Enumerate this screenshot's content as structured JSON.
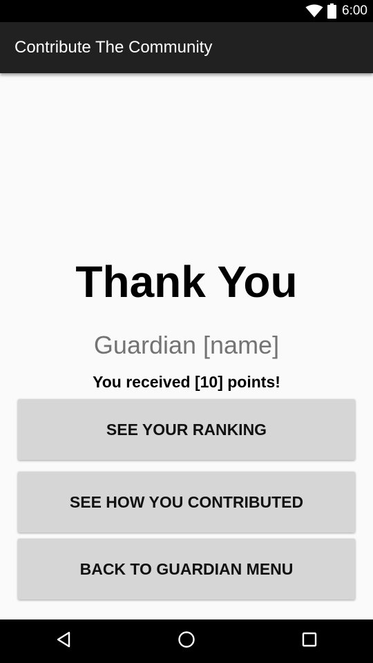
{
  "status_bar": {
    "time": "6:00",
    "icons": [
      "wifi-icon",
      "battery-icon"
    ]
  },
  "app_bar": {
    "title": "Contribute The Community"
  },
  "main": {
    "heading": "Thank You",
    "guardian_name": "Guardian [name]",
    "points_message": "You received [10] points!",
    "buttons": [
      {
        "label": "SEE YOUR RANKING"
      },
      {
        "label": "SEE HOW YOU CONTRIBUTED"
      },
      {
        "label": "BACK TO GUARDIAN MENU"
      }
    ]
  },
  "nav_bar": {
    "icons": [
      "back-icon",
      "home-icon",
      "recents-icon"
    ]
  },
  "colors": {
    "app_bar": "#212121",
    "status_bar": "#000000",
    "background": "#fafafa",
    "button": "#d6d6d6",
    "subtitle_text": "#737373"
  }
}
